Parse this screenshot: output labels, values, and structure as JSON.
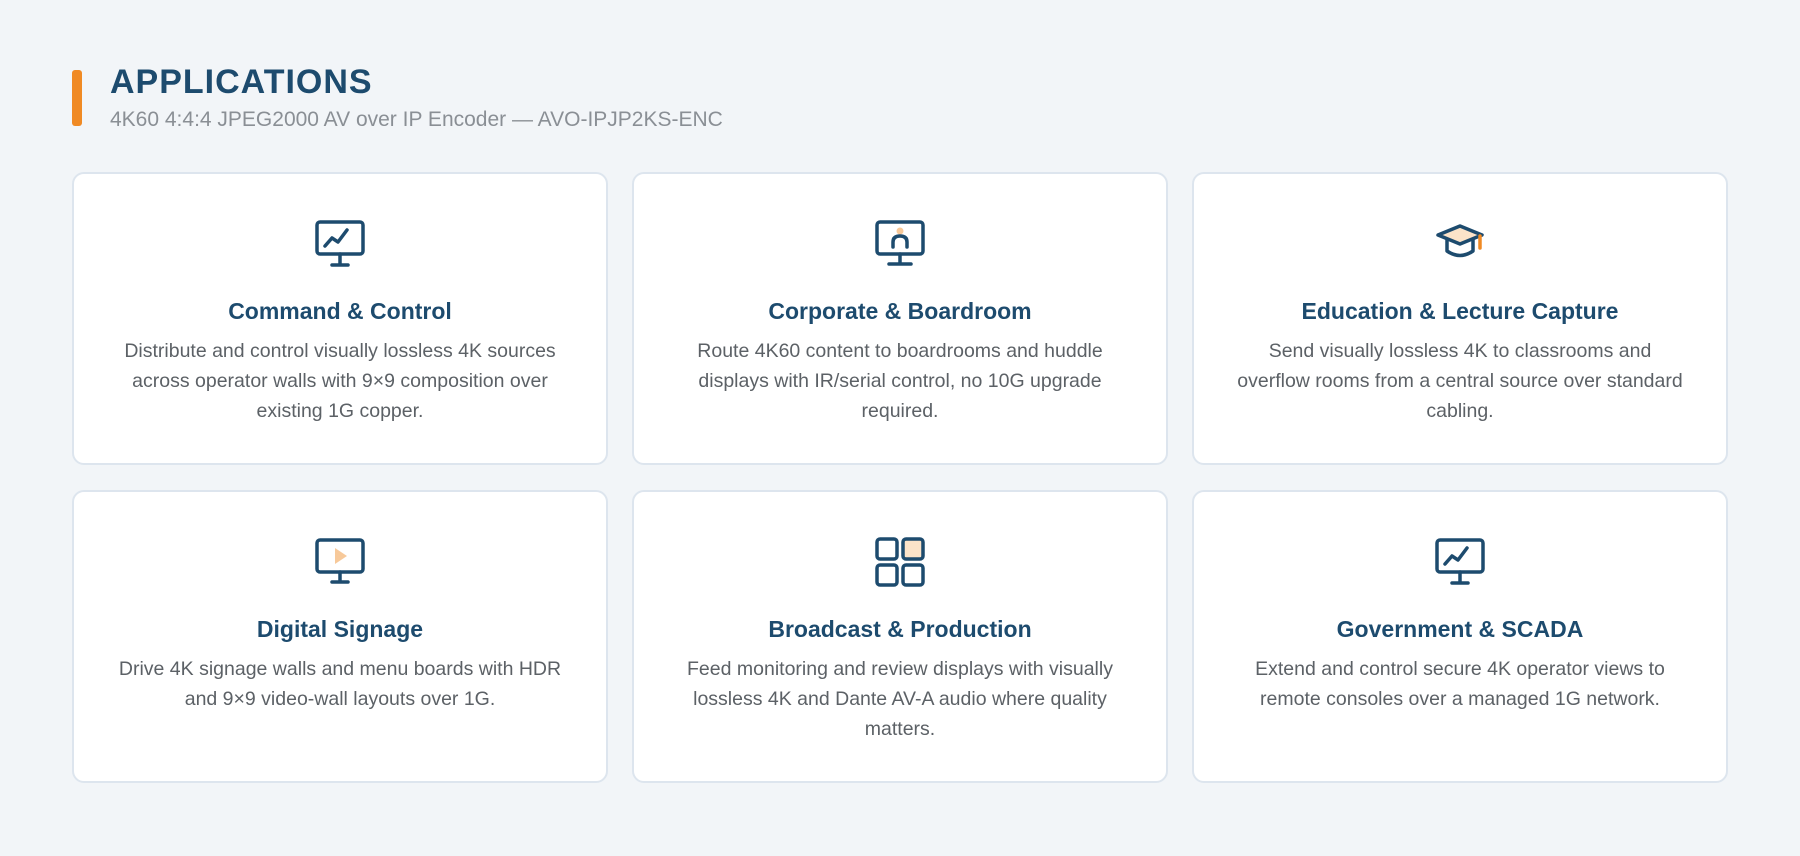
{
  "header": {
    "title": "APPLICATIONS",
    "subtitle": "4K60 4:4:4 JPEG2000 AV over IP Encoder — AVO-IPJP2KS-ENC"
  },
  "colors": {
    "accent": "#f08a24",
    "primary": "#1d4b6e",
    "background": "#f2f5f8"
  },
  "cards": [
    {
      "icon": "monitor-chart-icon",
      "title": "Command & Control",
      "description": "Distribute and control visually lossless 4K sources across operator walls with 9×9 composition over existing 1G copper."
    },
    {
      "icon": "monitor-presenter-icon",
      "title": "Corporate & Boardroom",
      "description": "Route 4K60 content to boardrooms and huddle displays with IR/serial control, no 10G upgrade required."
    },
    {
      "icon": "graduation-cap-icon",
      "title": "Education & Lecture Capture",
      "description": "Send visually lossless 4K to classrooms and overflow rooms from a central source over standard cabling."
    },
    {
      "icon": "monitor-play-icon",
      "title": "Digital Signage",
      "description": "Drive 4K signage walls and menu boards with HDR and 9×9 video-wall layouts over 1G."
    },
    {
      "icon": "grid-icon",
      "title": "Broadcast & Production",
      "description": "Feed monitoring and review displays with visually lossless 4K and Dante AV-A audio where quality matters."
    },
    {
      "icon": "monitor-chart-icon",
      "title": "Government & SCADA",
      "description": "Extend and control secure 4K operator views to remote consoles over a managed 1G network."
    }
  ]
}
